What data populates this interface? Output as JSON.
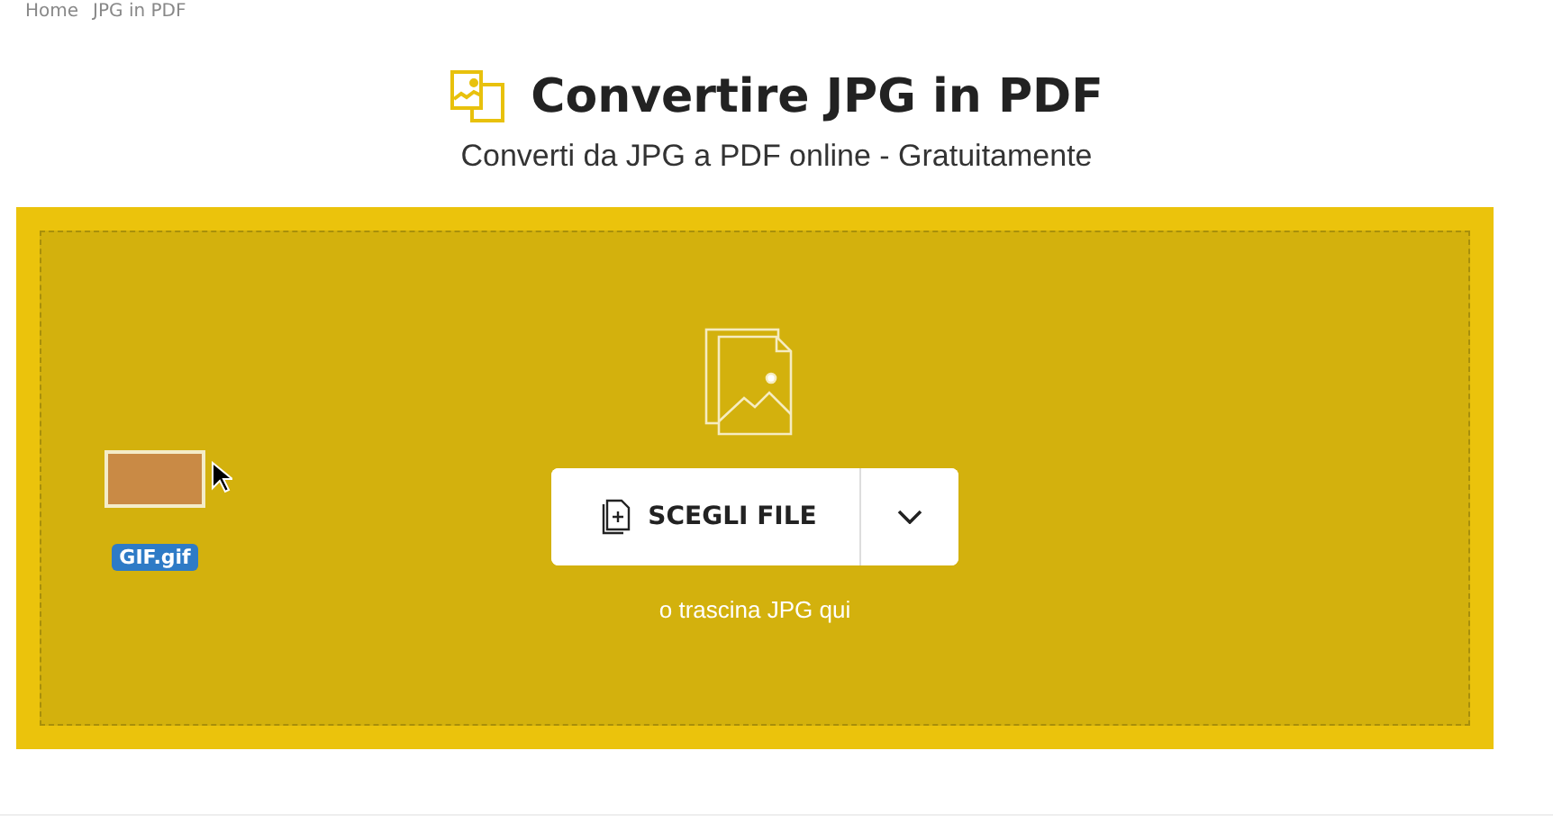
{
  "breadcrumb": [
    "Home",
    "JPG in PDF"
  ],
  "header": {
    "title": "Convertire JPG in PDF",
    "subtitle": "Converti da JPG a PDF online - Gratuitamente"
  },
  "dropzone": {
    "choose_button": "SCEGLI FILE",
    "hint": "o trascina JPG qui",
    "dragged_file": {
      "name": "GIF.gif"
    }
  }
}
